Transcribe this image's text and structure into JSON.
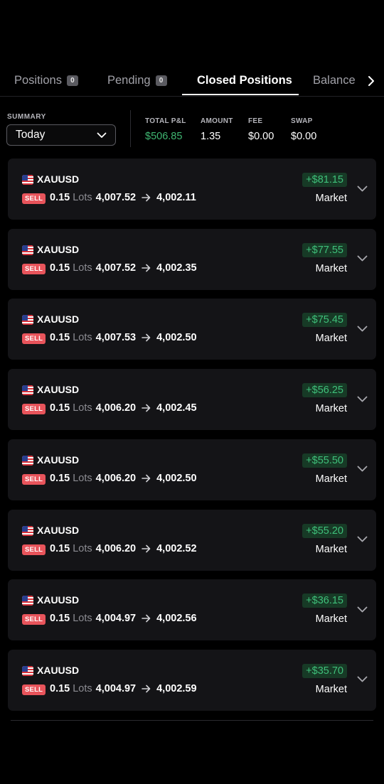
{
  "tabs": [
    {
      "label": "Positions",
      "badge": "0",
      "active": false
    },
    {
      "label": "Pending",
      "badge": "0",
      "active": false
    },
    {
      "label": "Closed Positions",
      "active": true
    },
    {
      "label": "Balance",
      "active": false
    }
  ],
  "summary": {
    "label": "SUMMARY",
    "period": "Today",
    "stats": {
      "total_pnl": {
        "label": "TOTAL P&L",
        "value": "$506.85"
      },
      "amount": {
        "label": "AMOUNT",
        "value": "1.35"
      },
      "fee": {
        "label": "FEE",
        "value": "$0.00"
      },
      "swap": {
        "label": "SWAP",
        "value": "$0.00"
      }
    }
  },
  "positions": [
    {
      "symbol": "XAUUSD",
      "side": "SELL",
      "lots": "0.15",
      "lots_unit": "Lots",
      "open_price": "4,007.52",
      "close_price": "4,002.11",
      "pnl": "+$81.15",
      "order_type": "Market"
    },
    {
      "symbol": "XAUUSD",
      "side": "SELL",
      "lots": "0.15",
      "lots_unit": "Lots",
      "open_price": "4,007.52",
      "close_price": "4,002.35",
      "pnl": "+$77.55",
      "order_type": "Market"
    },
    {
      "symbol": "XAUUSD",
      "side": "SELL",
      "lots": "0.15",
      "lots_unit": "Lots",
      "open_price": "4,007.53",
      "close_price": "4,002.50",
      "pnl": "+$75.45",
      "order_type": "Market"
    },
    {
      "symbol": "XAUUSD",
      "side": "SELL",
      "lots": "0.15",
      "lots_unit": "Lots",
      "open_price": "4,006.20",
      "close_price": "4,002.45",
      "pnl": "+$56.25",
      "order_type": "Market"
    },
    {
      "symbol": "XAUUSD",
      "side": "SELL",
      "lots": "0.15",
      "lots_unit": "Lots",
      "open_price": "4,006.20",
      "close_price": "4,002.50",
      "pnl": "+$55.50",
      "order_type": "Market"
    },
    {
      "symbol": "XAUUSD",
      "side": "SELL",
      "lots": "0.15",
      "lots_unit": "Lots",
      "open_price": "4,006.20",
      "close_price": "4,002.52",
      "pnl": "+$55.20",
      "order_type": "Market"
    },
    {
      "symbol": "XAUUSD",
      "side": "SELL",
      "lots": "0.15",
      "lots_unit": "Lots",
      "open_price": "4,004.97",
      "close_price": "4,002.56",
      "pnl": "+$36.15",
      "order_type": "Market"
    },
    {
      "symbol": "XAUUSD",
      "side": "SELL",
      "lots": "0.15",
      "lots_unit": "Lots",
      "open_price": "4,004.97",
      "close_price": "4,002.59",
      "pnl": "+$35.70",
      "order_type": "Market"
    }
  ],
  "icons": {
    "flag": "us-flag-icon",
    "arrow": "arrow-right-icon",
    "expand": "chevron-down-icon",
    "tabs_next": "chevron-right-icon"
  },
  "colors": {
    "background": "#000000",
    "card": "#141417",
    "profit": "#3fc07a",
    "sell_badge": "#e8545b"
  }
}
